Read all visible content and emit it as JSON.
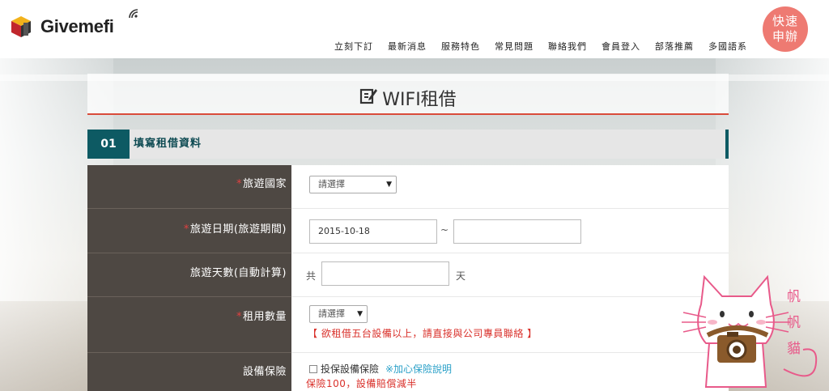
{
  "header": {
    "logo_text": "Givemefi",
    "nav": [
      {
        "label": "立刻下訂"
      },
      {
        "label": "最新消息"
      },
      {
        "label": "服務特色"
      },
      {
        "label": "常見問題"
      },
      {
        "label": "聯絡我們"
      },
      {
        "label": "會員登入"
      },
      {
        "label": "部落推薦"
      },
      {
        "label": "多國語系"
      }
    ],
    "quick_button": {
      "line1": "快速",
      "line2": "申辦"
    }
  },
  "page": {
    "title": "WIFI租借",
    "step_number": "01",
    "step_label": "填寫租借資料"
  },
  "form": {
    "country": {
      "required_mark": "*",
      "label": "旅遊國家",
      "select_value": "請選擇"
    },
    "dates": {
      "required_mark": "*",
      "label": "旅遊日期(旅遊期間)",
      "start_value": "2015-10-18",
      "separator": "~",
      "end_value": ""
    },
    "days": {
      "label": "旅遊天數(自動計算)",
      "prefix": "共",
      "value": "",
      "suffix": "天"
    },
    "quantity": {
      "required_mark": "*",
      "label": "租用數量",
      "select_value": "請選擇",
      "warning": "【 欲租借五台設備以上，請直接與公司專員聯絡 】"
    },
    "insurance": {
      "label": "設備保險",
      "checkbox_label": "投保設備保險",
      "link": "※加心保險說明",
      "note": "保險100，設備賠償減半"
    }
  },
  "mascot": {
    "chars": [
      "帆",
      "帆",
      "貓"
    ]
  },
  "colors": {
    "accent_red": "#d94b3a",
    "teal": "#0d5a63",
    "label_bg": "#4e4843",
    "quick_btn": "#ee7a72",
    "link": "#2aa0c8"
  }
}
